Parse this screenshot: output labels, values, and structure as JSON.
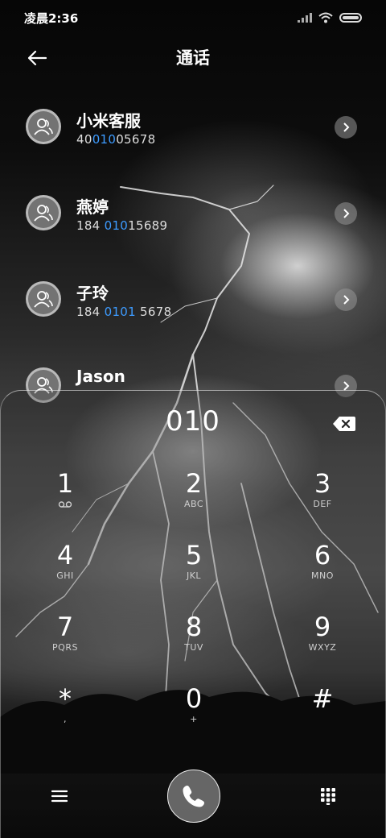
{
  "status_bar": {
    "time": "凌晨2:36"
  },
  "header": {
    "title": "通话"
  },
  "contacts": [
    {
      "name": "小米客服",
      "number_pre": "40",
      "number_match": "010",
      "number_post": "05678"
    },
    {
      "name": "燕婷",
      "number_pre": "184 ",
      "number_match": "010",
      "number_post": "15689"
    },
    {
      "name": "子玲",
      "number_pre": "184 ",
      "number_match": "0101",
      "number_post": " 5678"
    },
    {
      "name": "Jason",
      "number_pre": "",
      "number_match": "",
      "number_post": ""
    }
  ],
  "dialpad": {
    "input": "010",
    "keys": [
      {
        "digit": "1",
        "letters": ""
      },
      {
        "digit": "2",
        "letters": "ABC"
      },
      {
        "digit": "3",
        "letters": "DEF"
      },
      {
        "digit": "4",
        "letters": "GHI"
      },
      {
        "digit": "5",
        "letters": "JKL"
      },
      {
        "digit": "6",
        "letters": "MNO"
      },
      {
        "digit": "7",
        "letters": "PQRS"
      },
      {
        "digit": "8",
        "letters": "TUV"
      },
      {
        "digit": "9",
        "letters": "WXYZ"
      },
      {
        "digit": "*",
        "letters": ","
      },
      {
        "digit": "0",
        "letters": "+"
      },
      {
        "digit": "#",
        "letters": ""
      }
    ]
  },
  "icons": {
    "back": "back-arrow-icon",
    "avatar": "person-icon",
    "chevron": "chevron-right-icon",
    "backspace": "backspace-icon",
    "voicemail": "voicemail-icon",
    "menu": "menu-icon",
    "call": "phone-icon",
    "keypad": "dialpad-icon"
  },
  "colors": {
    "match_highlight": "#3d9bff"
  }
}
